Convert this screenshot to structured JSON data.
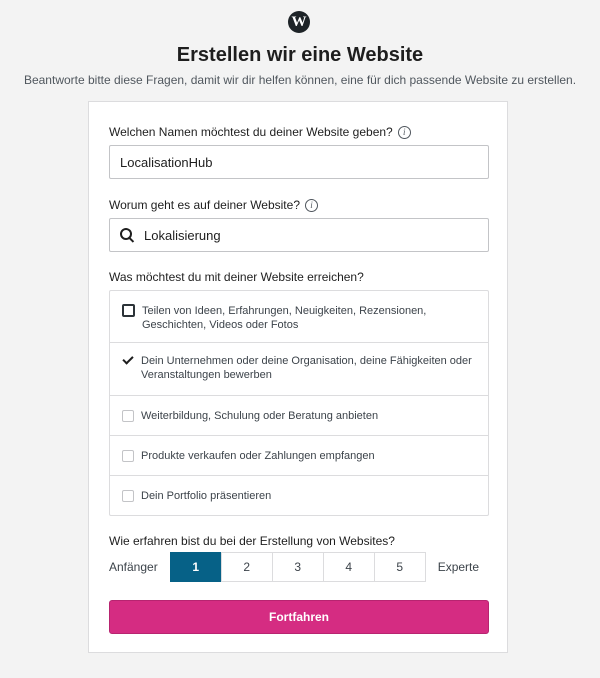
{
  "page": {
    "title": "Erstellen wir eine Website",
    "subtitle": "Beantworte bitte diese Fragen, damit wir dir helfen können, eine für dich passende Website zu erstellen.",
    "logo_glyph": "W"
  },
  "form": {
    "site_name": {
      "label": "Welchen Namen möchtest du deiner Website geben?",
      "value": "LocalisationHub"
    },
    "topic": {
      "label": "Worum geht es auf deiner Website?",
      "value": "Lokalisierung"
    },
    "goals": {
      "label": "Was möchtest du mit deiner Website erreichen?",
      "items": [
        {
          "label": "Teilen von Ideen, Erfahrungen, Neuigkeiten, Rezensionen, Geschichten, Videos oder Fotos",
          "checked": false
        },
        {
          "label": "Dein Unternehmen oder deine Organisation, deine Fähigkeiten oder Veranstaltungen bewerben",
          "checked": true
        },
        {
          "label": "Weiterbildung, Schulung oder Beratung anbieten",
          "checked": false
        },
        {
          "label": "Produkte verkaufen oder Zahlungen empfangen",
          "checked": false
        },
        {
          "label": "Dein Portfolio präsentieren",
          "checked": false
        }
      ]
    },
    "experience": {
      "label": "Wie erfahren bist du bei der Erstellung von Websites?",
      "min_label": "Anfänger",
      "max_label": "Experte",
      "options": [
        "1",
        "2",
        "3",
        "4",
        "5"
      ],
      "selected": "1"
    },
    "submit_label": "Fortfahren"
  },
  "colors": {
    "accent": "#066187",
    "primary_button": "#d52c82"
  }
}
